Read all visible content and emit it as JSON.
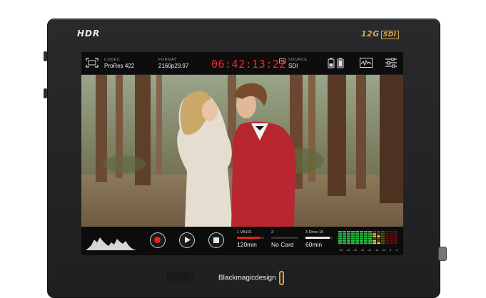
{
  "device": {
    "hdr_badge": "HDR",
    "sdi_badge_num": "12G",
    "sdi_badge_text": "SDI",
    "brand_prefix": "Blackmagic",
    "brand_suffix": "design"
  },
  "topbar": {
    "codec_label": "CODEC",
    "codec_value": "ProRes 422",
    "format_label": "FORMAT",
    "format_value": "2160p29.97",
    "timecode": "06:42:13:22",
    "tc_badge": "TC",
    "source_label": "SOURCE",
    "source_value": "SDI",
    "icons": [
      "fullscreen-icon",
      "battery-icon",
      "waveform-scope-icon",
      "settings-sliders-icon"
    ]
  },
  "transport": {
    "record_color": "#e52121",
    "icons": [
      "histogram-icon",
      "record-icon",
      "play-icon",
      "stop-icon"
    ]
  },
  "slots": [
    {
      "header": "1  VA101",
      "value": "120min",
      "bar_color": "#e52121",
      "fill": 0.85
    },
    {
      "header": "2",
      "value": "No Card",
      "bar_color": "#555555",
      "fill": 0.0
    },
    {
      "header": "3  Drive 16",
      "value": "60min",
      "bar_color": "#e8e8e8",
      "fill": 0.9
    }
  ],
  "audio_meter": {
    "scale": [
      "-50",
      "-40",
      "-30",
      "-25",
      "-20",
      "-15",
      "-10",
      "-5",
      "0"
    ],
    "colors": {
      "green": "#2ec84a",
      "yellow": "#e6d233",
      "red": "#e52121"
    }
  }
}
